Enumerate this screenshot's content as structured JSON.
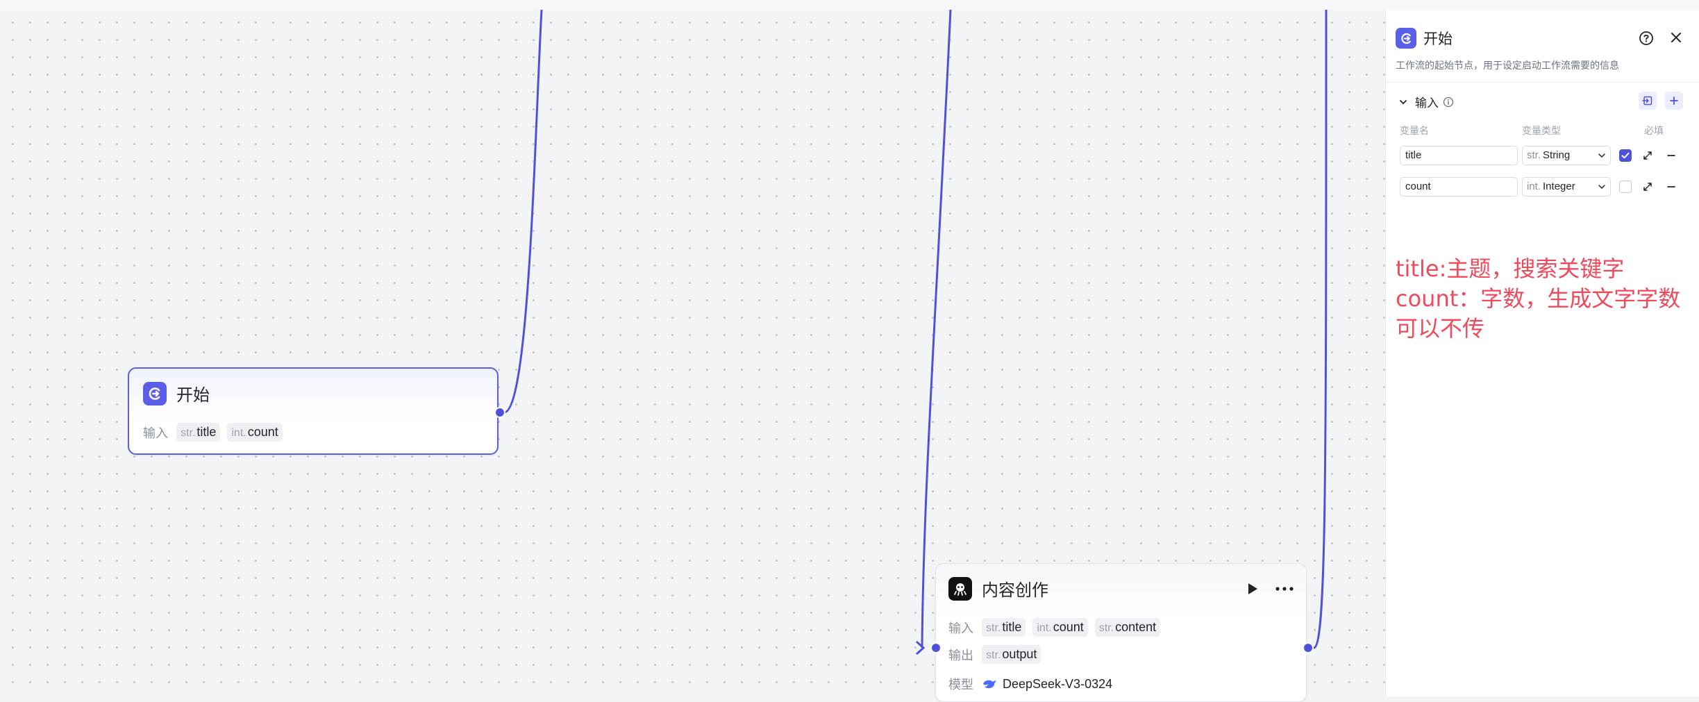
{
  "start_node": {
    "title": "开始",
    "input_label": "输入",
    "params": [
      {
        "type": "str.",
        "name": "title"
      },
      {
        "type": "int.",
        "name": "count"
      }
    ]
  },
  "content_node": {
    "title": "内容创作",
    "input_label": "输入",
    "inputs": [
      {
        "type": "str.",
        "name": "title"
      },
      {
        "type": "int.",
        "name": "count"
      },
      {
        "type": "str.",
        "name": "content"
      }
    ],
    "output_label": "输出",
    "outputs": [
      {
        "type": "str.",
        "name": "output"
      }
    ],
    "model_label": "模型",
    "model": "DeepSeek-V3-0324"
  },
  "panel": {
    "title": "开始",
    "description": "工作流的起始节点，用于设定启动工作流需要的信息",
    "section_title": "输入",
    "columns": {
      "name": "变量名",
      "type": "变量类型",
      "required": "必填"
    },
    "variables": [
      {
        "name": "title",
        "type_prefix": "str.",
        "type_name": "String",
        "required": true
      },
      {
        "name": "count",
        "type_prefix": "int.",
        "type_name": "Integer",
        "required": false
      }
    ],
    "note_lines": [
      "title:主题，搜索关键字",
      "count：字数，生成文字字数",
      "可以不传"
    ]
  },
  "colors": {
    "accent": "#4f52d9",
    "note": "#ef4a5c"
  }
}
